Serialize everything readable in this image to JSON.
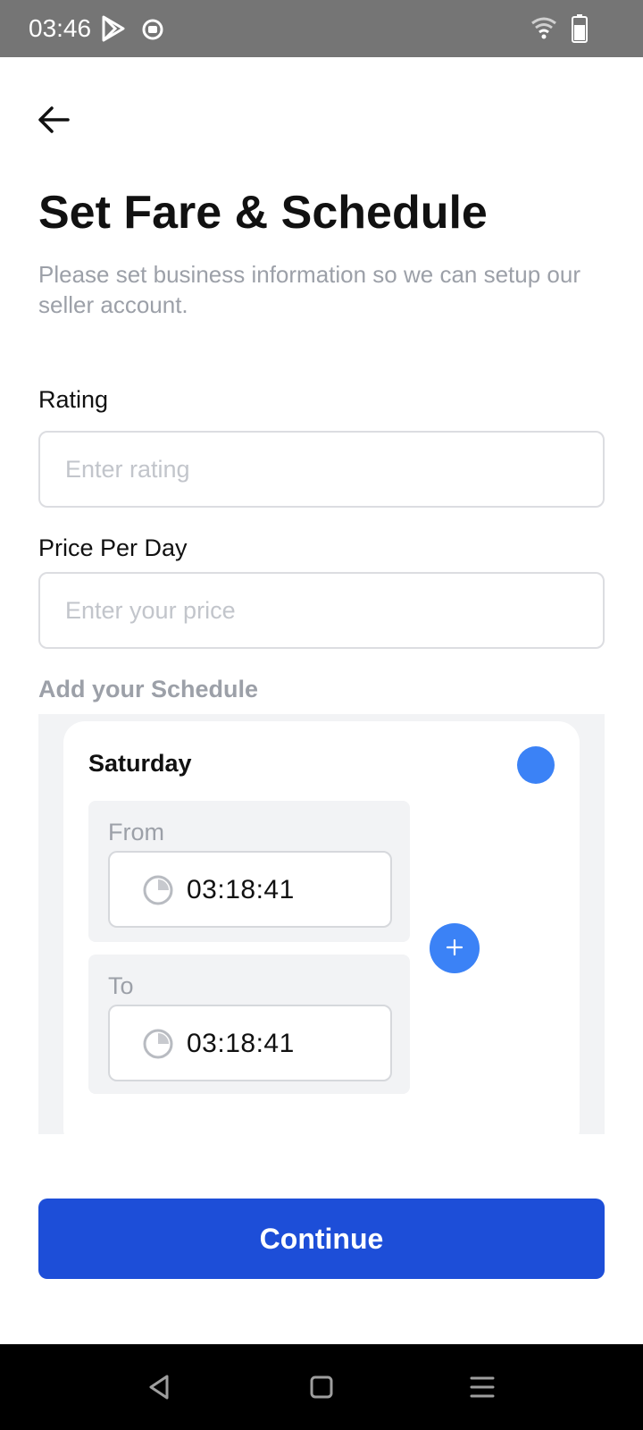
{
  "status_bar": {
    "time": "03:46",
    "icons": [
      "play-store-icon",
      "record-icon",
      "wifi-icon",
      "battery-icon"
    ]
  },
  "header": {
    "back_icon": "arrow-left-icon",
    "title": "Set Fare & Schedule",
    "subtitle": "Please set business information so we can setup our seller account."
  },
  "form": {
    "rating": {
      "label": "Rating",
      "placeholder": "Enter rating",
      "value": ""
    },
    "price": {
      "label": "Price Per Day",
      "placeholder": "Enter your price",
      "value": ""
    }
  },
  "schedule": {
    "heading": "Add your Schedule",
    "days": [
      {
        "name": "Saturday",
        "enabled": true,
        "from_label": "From",
        "from_time": "03:18:41",
        "to_label": "To",
        "to_time": "03:18:41",
        "add_icon": "plus-icon"
      }
    ]
  },
  "actions": {
    "continue_label": "Continue"
  },
  "colors": {
    "primary": "#1d4ed8",
    "accent": "#3b82f6",
    "muted_text": "#9ca0a8",
    "status_bar": "#757575"
  },
  "nav_bar": {
    "icons": [
      "back-triangle-icon",
      "home-square-icon",
      "menu-lines-icon"
    ]
  }
}
